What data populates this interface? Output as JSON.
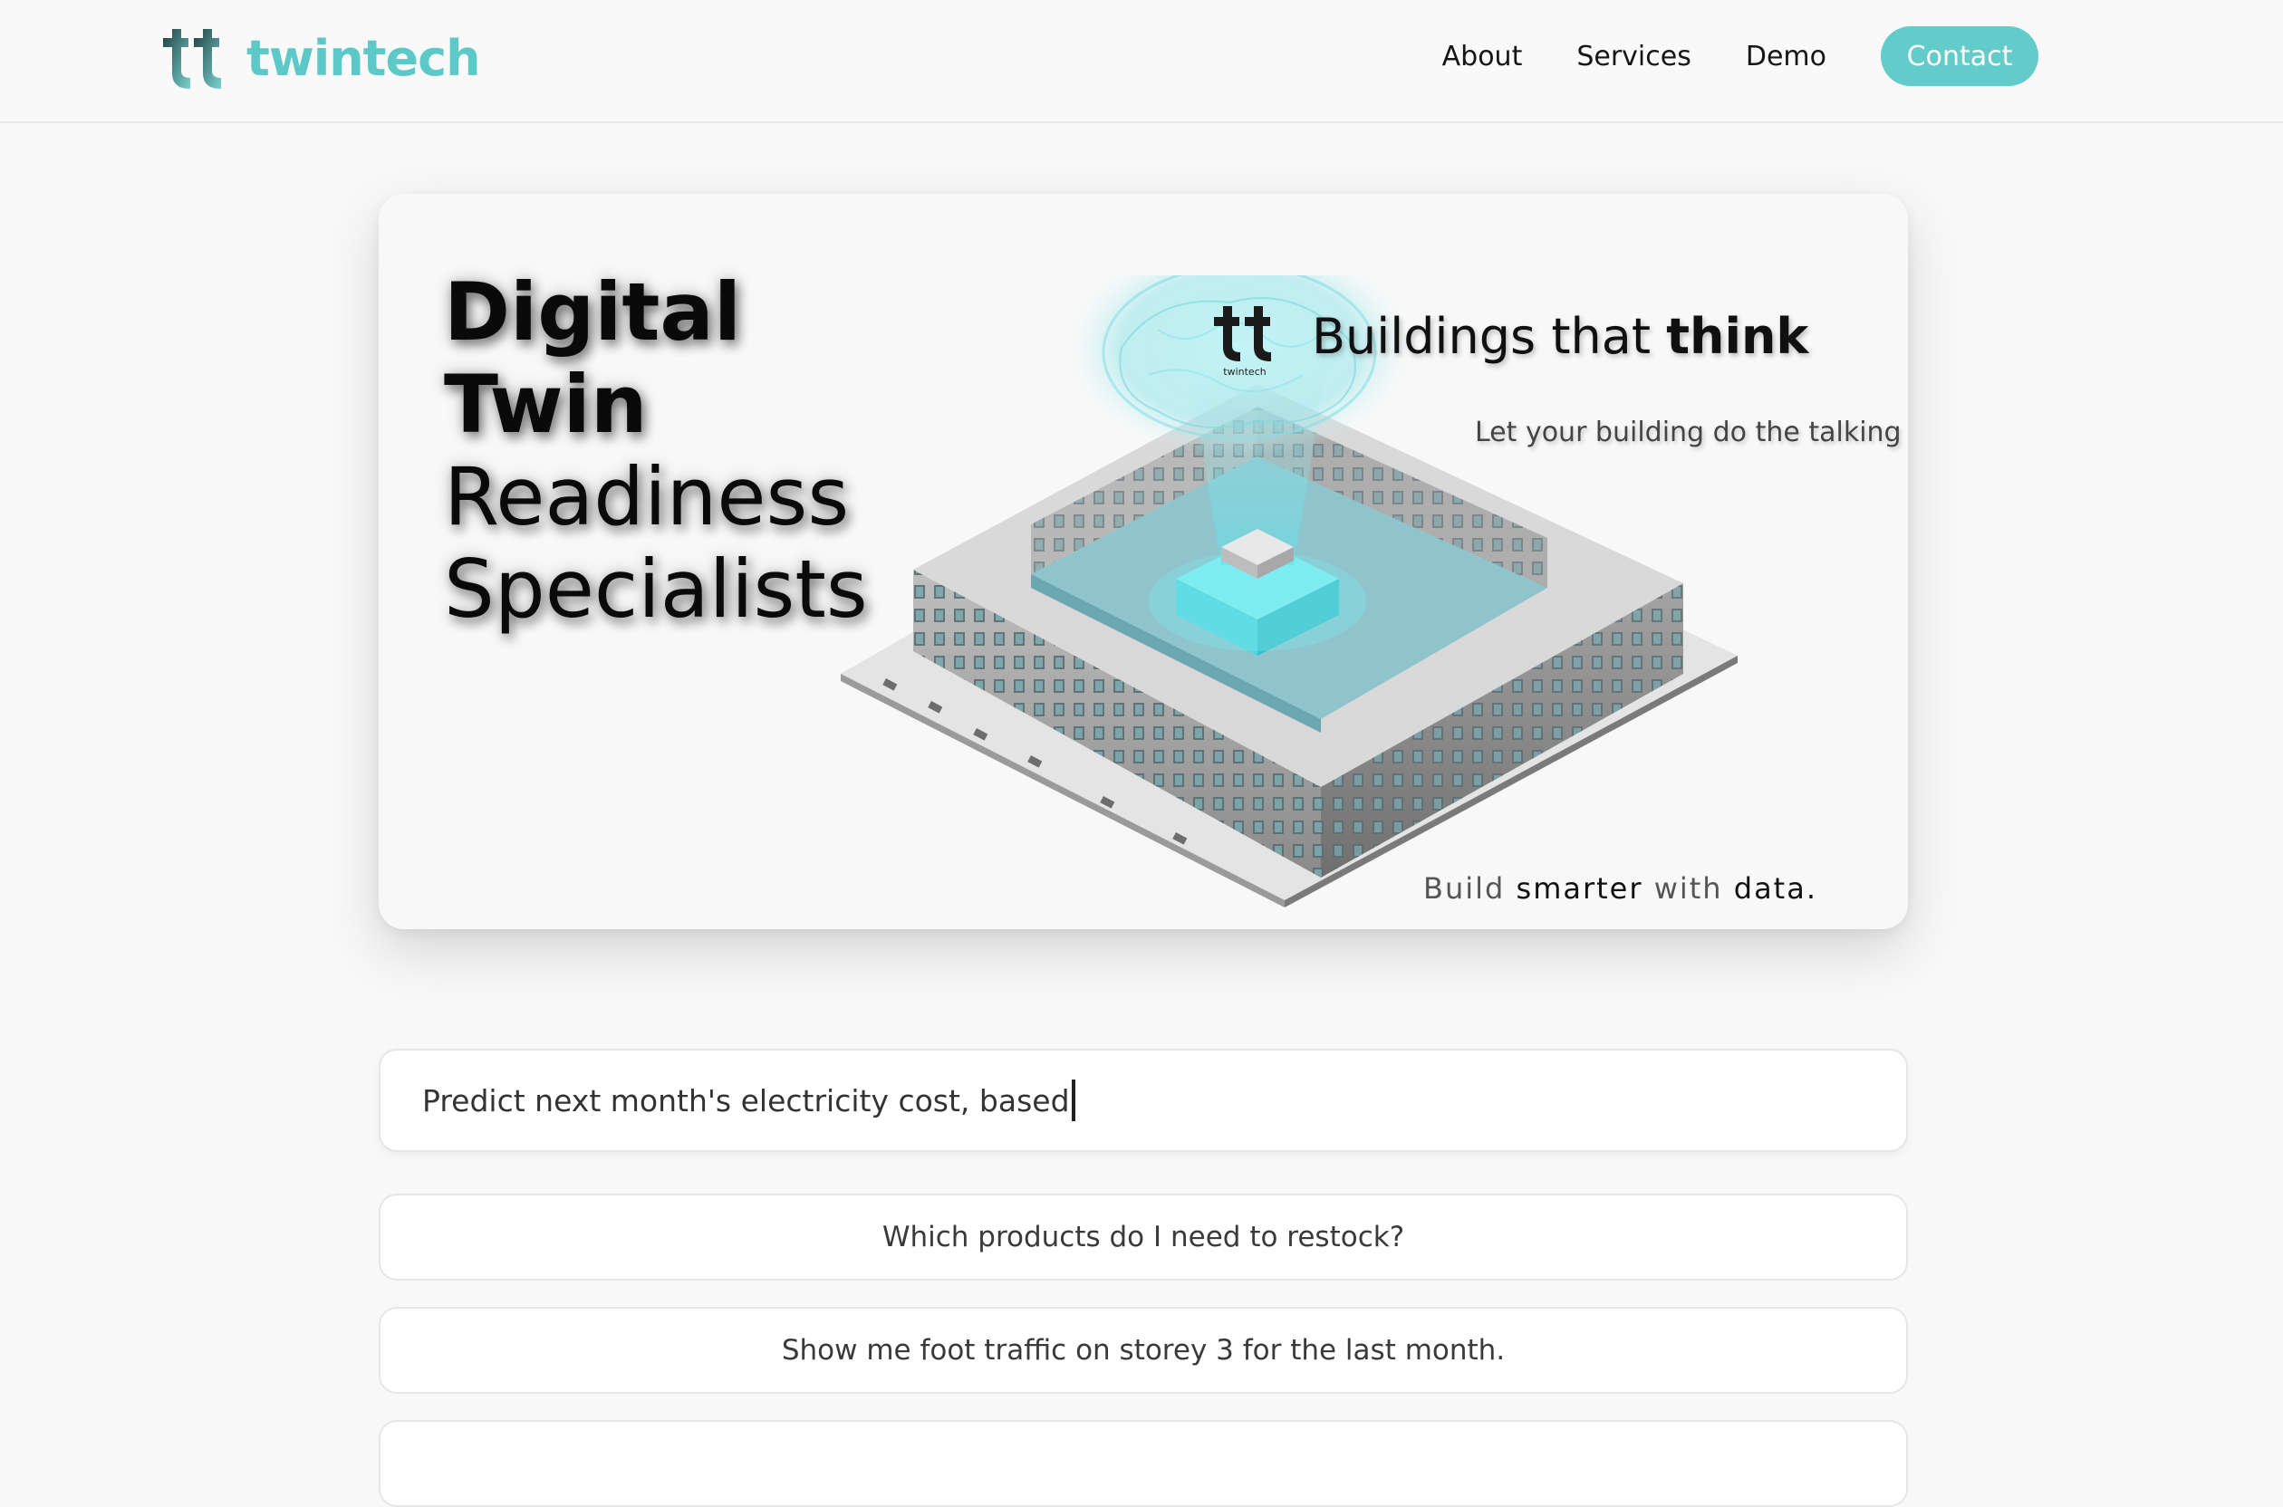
{
  "header": {
    "logo_text": "twintech",
    "nav": {
      "about": "About",
      "services": "Services",
      "demo": "Demo",
      "contact": "Contact"
    }
  },
  "hero": {
    "heading": [
      "Digital",
      "Twin",
      "Readiness",
      "Specialists"
    ],
    "tagline_prefix": "Buildings that ",
    "tagline_emphasis": "think",
    "subtagline": "Let your building do the talking",
    "slogan": {
      "w1": "Build ",
      "w2": "smarter",
      "w3": " with ",
      "w4": "data."
    },
    "mini_logo_caption": "twintech"
  },
  "query": {
    "value": "Predict next month's electricity cost, based"
  },
  "suggestions": [
    "Which products do I need to restock?",
    "Show me foot traffic on storey 3 for the last month."
  ],
  "colors": {
    "accent": "#63cbc9",
    "logo_text": "#5cc8c8",
    "glow": "#7fe8ee"
  }
}
